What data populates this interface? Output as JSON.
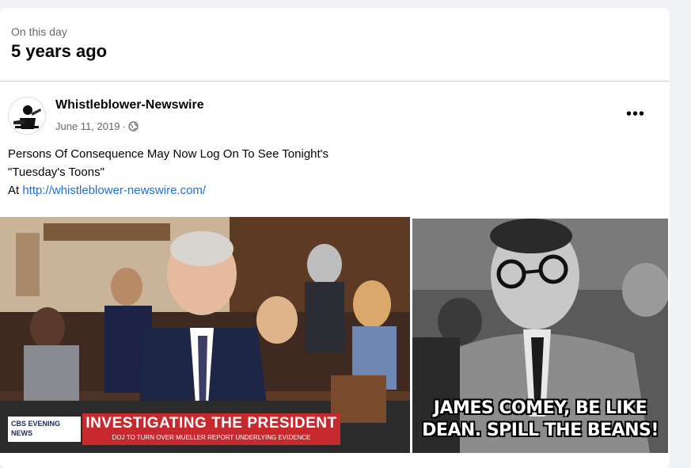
{
  "memory": {
    "subtitle": "On this day",
    "title": "5 years ago"
  },
  "post": {
    "page_name": "Whistleblower-Newswire",
    "date": "June 11, 2019",
    "date_separator": "·",
    "audience_icon": "globe-icon",
    "more_options_icon": "more-options-icon",
    "text_line1": "Persons Of Consequence May Now Log On To See Tonight's",
    "text_line2": "\"Tuesday's Toons\"",
    "text_prefix": "At ",
    "link": "http://whistleblower-newswire.com/"
  },
  "photos": {
    "left": {
      "network_logo": "CBS EVENING NEWS",
      "headline": "INVESTIGATING THE PRESIDENT",
      "subheadline": "DOJ TO TURN OVER MUELLER REPORT UNDERLYING EVIDENCE"
    },
    "right": {
      "caption_line1": "JAMES COMEY, BE LIKE",
      "caption_line2": "DEAN. SPILL THE BEANS!"
    }
  },
  "colors": {
    "link": "#216fdb",
    "banner_red": "#c62a2f",
    "secondary_text": "#65676b"
  }
}
